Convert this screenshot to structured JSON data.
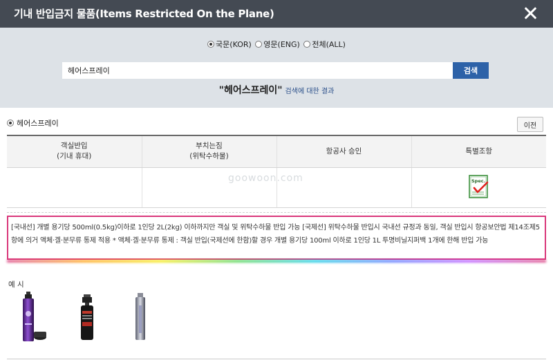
{
  "header": {
    "title": "기내 반입금지 물품(Items Restricted On the Plane)"
  },
  "language": {
    "options": [
      {
        "label": "국문(KOR)",
        "checked": true
      },
      {
        "label": "영문(ENG)",
        "checked": false
      },
      {
        "label": "전체(ALL)",
        "checked": false
      }
    ]
  },
  "search": {
    "value": "헤어스프레이",
    "button_label": "검색"
  },
  "result": {
    "term": "\"헤어스프레이\"",
    "suffix": "검색에 대한 결과"
  },
  "item": {
    "name": "헤어스프레이",
    "prev_label": "이전"
  },
  "table": {
    "headers": [
      [
        "객실반입",
        "(기내 휴대)"
      ],
      [
        "부치는짐",
        "(위탁수하물)"
      ],
      [
        "항공사 승인"
      ],
      [
        "특별조항"
      ]
    ],
    "spec_icon_text": "Spec."
  },
  "watermark": "goowoon.com",
  "notice": "[국내선] 개별 용기당 500ml(0.5kg)이하로 1인당 2L(2kg) 이하까지만 객실 및 위탁수하물 반입 가능 [국제선] 위탁수하물 반입시 국내선 규정과 동일, 객실 반입시 항공보안법 제14조제5항에 의거 액체·겔·분무류 통제 적용 * 액체·겔·분무류 통제 : 객실 반입(국제선에 한함)할 경우 개별 용기당 100ml 이하로 1인당 1L 투명비닐지퍼백 1개에 한해 반입 가능",
  "examples": {
    "label": "예 시",
    "items": [
      "purple-hairspray-can",
      "black-spray-bottle",
      "silver-hairspray-can"
    ]
  },
  "colors": {
    "header": "#444a53",
    "search_bg": "#dde2e7",
    "button": "#2d62a8",
    "notice_border": "#d9367a"
  }
}
